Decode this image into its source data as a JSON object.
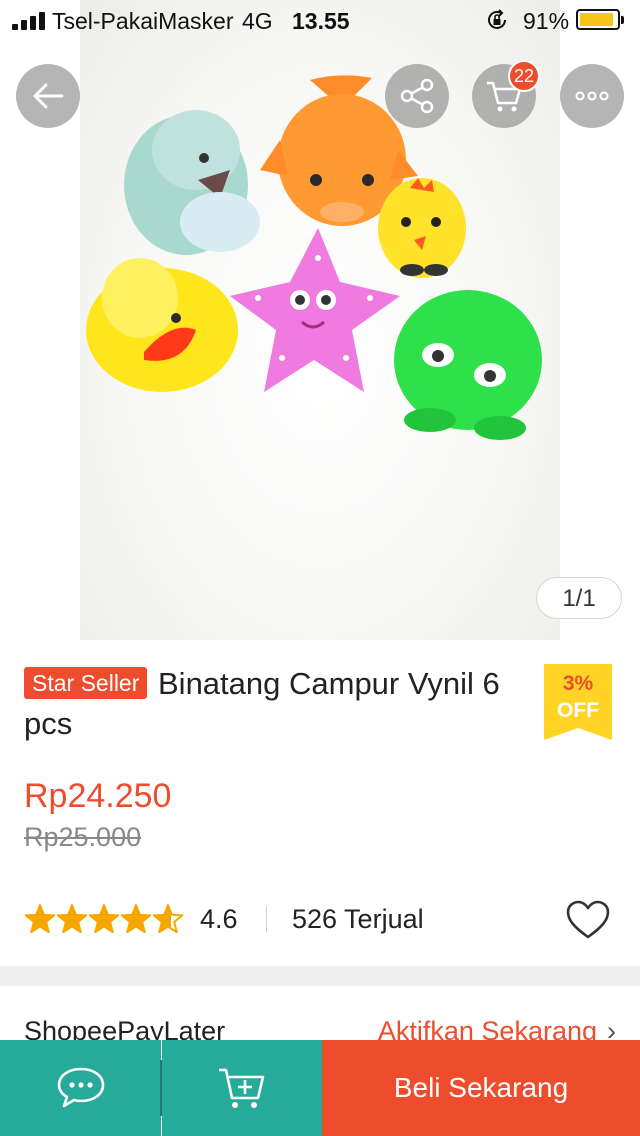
{
  "status_bar": {
    "carrier": "Tsel-PakaiMasker",
    "network": "4G",
    "time": "13.55",
    "battery_percent": "91%",
    "battery_level": 0.91,
    "battery_color": "#f5c518"
  },
  "header": {
    "back_icon": "arrow-left-icon",
    "share_icon": "share-icon",
    "cart_icon": "shopping-cart-icon",
    "cart_count": "22",
    "more_icon": "more-horizontal-icon"
  },
  "gallery": {
    "counter": "1/1"
  },
  "product": {
    "badge": "Star Seller",
    "title": "Binatang Campur Vynil 6 pcs",
    "discount_percent": "3%",
    "discount_label": "OFF",
    "price": "Rp24.250",
    "original_price": "Rp25.000",
    "rating": "4.6",
    "rating_stars": 4.6,
    "sold": "526 Terjual",
    "wishlist_icon": "heart-outline-icon"
  },
  "paylater": {
    "label": "ShopeePayLater",
    "action": "Aktifkan Sekarang"
  },
  "bottom_bar": {
    "chat_icon": "chat-icon",
    "add_to_cart_icon": "cart-plus-icon",
    "buy_label": "Beli Sekarang"
  },
  "colors": {
    "brand": "#ee4d2d",
    "secondary": "#26aa99",
    "star": "#f6a700",
    "discount_tag": "#ffd424"
  }
}
